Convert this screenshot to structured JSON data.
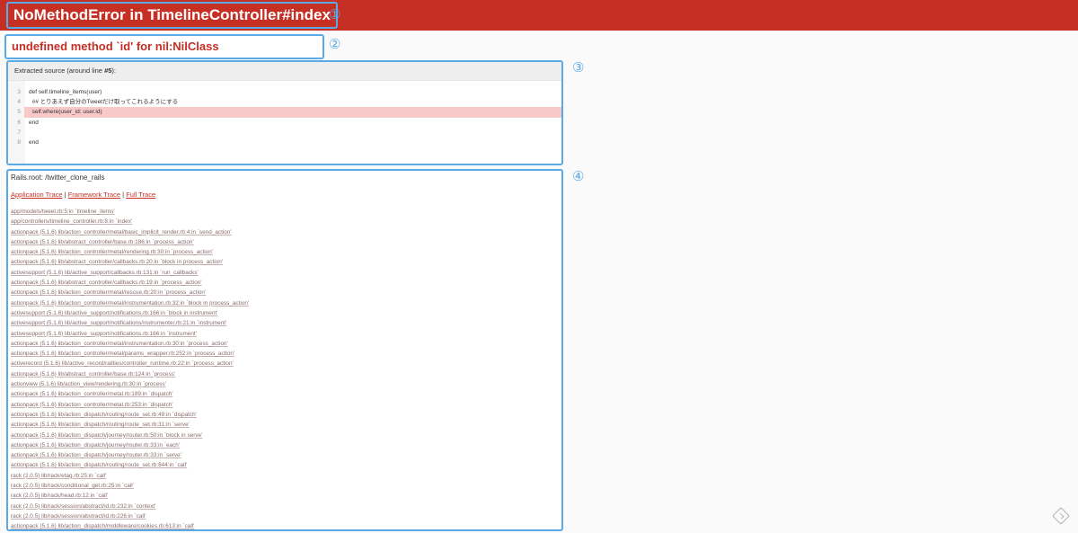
{
  "header": {
    "title": "NoMethodError in TimelineController#index"
  },
  "annotations": {
    "one": "①",
    "two": "②",
    "three": "③",
    "four": "④"
  },
  "message": "undefined method `id' for nil:NilClass",
  "source": {
    "heading_prefix": "Extracted source (around line ",
    "heading_line": "#5",
    "heading_suffix": "):",
    "lines": [
      {
        "num": "3",
        "text": "def self.timeline_items(user)"
      },
      {
        "num": "4",
        "text": "  ## とりあえず自分のTweetだけ取ってこれるようにする"
      },
      {
        "num": "5",
        "text": "  self.where(user_id: user.id)"
      },
      {
        "num": "6",
        "text": "end"
      },
      {
        "num": "7",
        "text": ""
      },
      {
        "num": "8",
        "text": "end"
      }
    ],
    "highlight_line": "5"
  },
  "trace": {
    "rails_root": "Rails.root: /twitter_clone_rails",
    "links": [
      "Application Trace",
      "Framework Trace",
      "Full Trace"
    ],
    "separator": "|",
    "frames": [
      "app/models/tweet.rb:5:in `timeline_items'",
      "app/controllers/timeline_controller.rb:8:in `index'",
      "actionpack (5.1.6) lib/action_controller/metal/basic_implicit_render.rb:4:in `send_action'",
      "actionpack (5.1.6) lib/abstract_controller/base.rb:186:in `process_action'",
      "actionpack (5.1.6) lib/action_controller/metal/rendering.rb:30:in `process_action'",
      "actionpack (5.1.6) lib/abstract_controller/callbacks.rb:20:in `block in process_action'",
      "activesupport (5.1.6) lib/active_support/callbacks.rb:131:in `run_callbacks'",
      "actionpack (5.1.6) lib/abstract_controller/callbacks.rb:19:in `process_action'",
      "actionpack (5.1.6) lib/action_controller/metal/rescue.rb:20:in `process_action'",
      "actionpack (5.1.6) lib/action_controller/metal/instrumentation.rb:32:in `block in process_action'",
      "activesupport (5.1.6) lib/active_support/notifications.rb:166:in `block in instrument'",
      "activesupport (5.1.6) lib/active_support/notifications/instrumenter.rb:21:in `instrument'",
      "activesupport (5.1.6) lib/active_support/notifications.rb:166:in `instrument'",
      "actionpack (5.1.6) lib/action_controller/metal/instrumentation.rb:30:in `process_action'",
      "actionpack (5.1.6) lib/action_controller/metal/params_wrapper.rb:252:in `process_action'",
      "activerecord (5.1.6) lib/active_record/railties/controller_runtime.rb:22:in `process_action'",
      "actionpack (5.1.6) lib/abstract_controller/base.rb:124:in `process'",
      "actionview (5.1.6) lib/action_view/rendering.rb:30:in `process'",
      "actionpack (5.1.6) lib/action_controller/metal.rb:189:in `dispatch'",
      "actionpack (5.1.6) lib/action_controller/metal.rb:253:in `dispatch'",
      "actionpack (5.1.6) lib/action_dispatch/routing/route_set.rb:49:in `dispatch'",
      "actionpack (5.1.6) lib/action_dispatch/routing/route_set.rb:31:in `serve'",
      "actionpack (5.1.6) lib/action_dispatch/journey/router.rb:50:in `block in serve'",
      "actionpack (5.1.6) lib/action_dispatch/journey/router.rb:33:in `each'",
      "actionpack (5.1.6) lib/action_dispatch/journey/router.rb:33:in `serve'",
      "actionpack (5.1.6) lib/action_dispatch/routing/route_set.rb:844:in `call'",
      "rack (2.0.5) lib/rack/etag.rb:25:in `call'",
      "rack (2.0.5) lib/rack/conditional_get.rb:25:in `call'",
      "rack (2.0.5) lib/rack/head.rb:12:in `call'",
      "rack (2.0.5) lib/rack/session/abstract/id.rb:232:in `context'",
      "rack (2.0.5) lib/rack/session/abstract/id.rb:226:in `call'",
      "actionpack (5.1.6) lib/action_dispatch/middleware/cookies.rb:613:in `call'"
    ]
  },
  "icons": {
    "corner": "feedly-icon"
  },
  "colors": {
    "header_bg": "#c52f24",
    "annotation": "#5aaae6",
    "highlight": "#f8c9c9"
  }
}
